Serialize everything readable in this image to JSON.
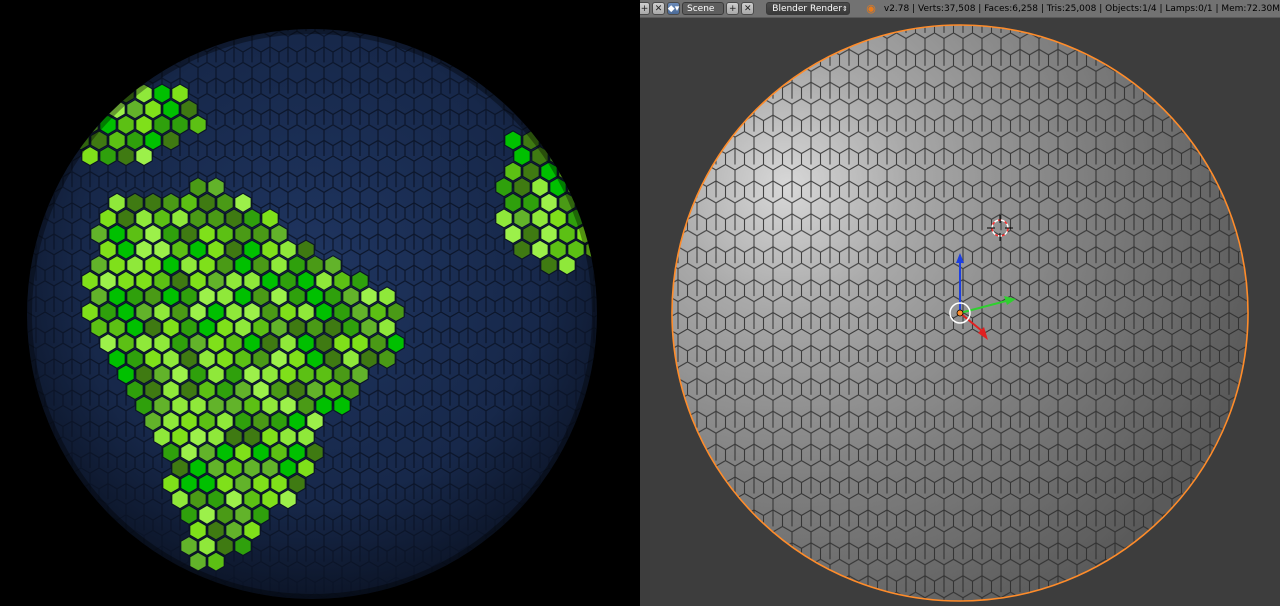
{
  "header": {
    "scene_icon": "scene-icon",
    "scene_name": "Scene",
    "render_engine": "Blender Render",
    "blender_logo": "blender-logo-icon",
    "stats": "v2.78 | Verts:37,508 | Faces:6,258 | Tris:25,008 | Objects:1/4 | Lamps:0/1 | Mem:72.30M"
  },
  "colors": {
    "ocean": "#1a2b4f",
    "land_light": "#7fe01a",
    "land_dark": "#3f7a12",
    "viewport_bg": "#3d3d3d",
    "selection_outline": "#ff8c2a"
  }
}
